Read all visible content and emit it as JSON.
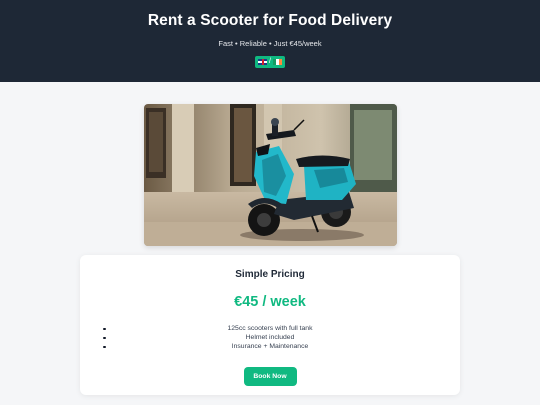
{
  "hero": {
    "title": "Rent a Scooter for Food Delivery",
    "tagline": "Fast • Reliable • Just €45/week",
    "language": {
      "separator": "/"
    }
  },
  "pricing": {
    "title": "Simple Pricing",
    "price": "€45 / week",
    "features": [
      "125cc scooters with full tank",
      "Helmet included",
      "Insurance + Maintenance"
    ],
    "cta_label": "Book Now"
  },
  "colors": {
    "header_bg": "#1e2836",
    "accent": "#10b981",
    "page_bg": "#f5f6f8"
  },
  "icons": [
    "uk-flag-icon",
    "ireland-flag-icon"
  ]
}
